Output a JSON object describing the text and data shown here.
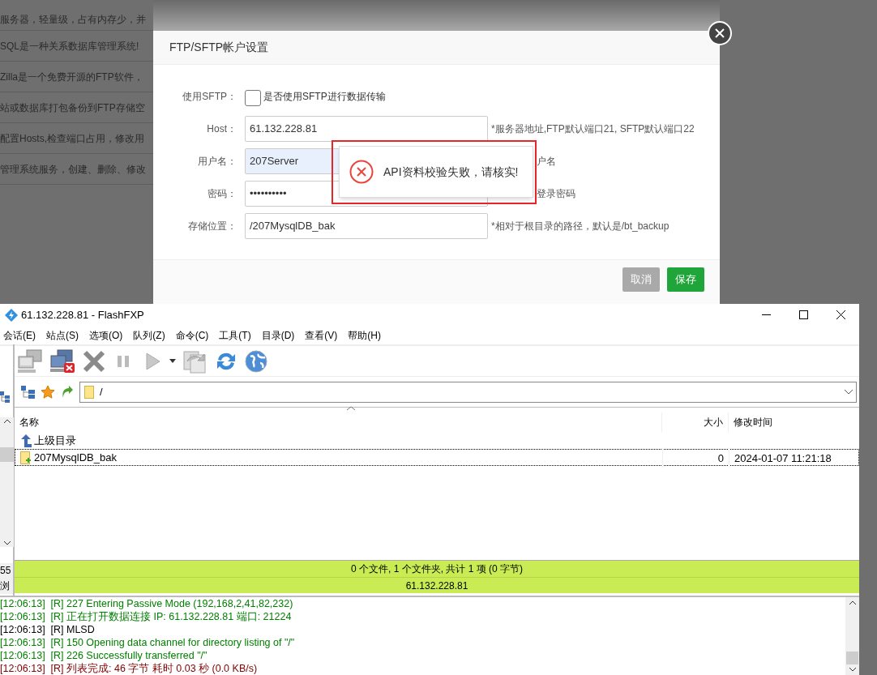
{
  "background_page": {
    "rows": [
      "服务器，轻量级，占有内存少，并",
      "SQL是一种关系数据库管理系统!",
      "Zilla是一个免费开源的FTP软件，",
      "站或数据库打包备份到FTP存储空",
      "配置Hosts,检查端口占用，修改用",
      "管理系统服务，创建、删除、修改"
    ]
  },
  "dialog": {
    "title": "FTP/SFTP帐户设置",
    "fields": [
      {
        "kind": "checkbox",
        "label": "使用SFTP：",
        "checked": false,
        "text": "是否使用SFTP进行数据传输"
      },
      {
        "kind": "input",
        "label": "Host：",
        "value": "61.132.228.81",
        "autofilled": false,
        "hint": "*服务器地址,FTP默认端口21, SFTP默认端口22"
      },
      {
        "kind": "input",
        "label": "用户名：",
        "value": "207Server",
        "autofilled": true,
        "hint": "户名"
      },
      {
        "kind": "input",
        "label": "密码：",
        "value": "••••••••••",
        "autofilled": false,
        "hint": "登录密码"
      },
      {
        "kind": "input",
        "label": "存储位置：",
        "value": "/207MysqlDB_bak",
        "autofilled": false,
        "hint": "*相对于根目录的路径，默认是/bt_backup"
      }
    ],
    "buttons": [
      {
        "label": "取消",
        "disabled": true
      },
      {
        "label": "保存",
        "disabled": false
      }
    ]
  },
  "toast": {
    "message": "API资料校验失败，请核实!"
  },
  "ftp_window": {
    "title": "61.132.228.81 - FlashFXP",
    "menu": [
      "会话(E)",
      "站点(S)",
      "选项(O)",
      "队列(Z)",
      "命令(C)",
      "工具(T)",
      "目录(D)",
      "查看(V)",
      "帮助(H)"
    ],
    "left_pane": {
      "labels": [
        "55",
        "浏"
      ]
    },
    "path": "/",
    "columns": [
      "名称",
      "大小",
      "修改时间"
    ],
    "rows": [
      {
        "kind": "parent",
        "name": "上级目录",
        "selected": false
      },
      {
        "kind": "folder",
        "name": "207MysqlDB_bak",
        "size": "0",
        "modified": "2024-01-07 11:21:18",
        "selected": true
      }
    ],
    "status": [
      "0 个文件, 1 个文件夹, 共计 1 项 (0 字节)",
      "61.132.228.81"
    ],
    "log": [
      {
        "text": "[12:06:13]  [R] 227 Entering Passive Mode (192,168,2,41,82,232)",
        "color": "#008000"
      },
      {
        "text": "[12:06:13]  [R] 正在打开数据连接 IP: 61.132.228.81 端口: 21224",
        "color": "#008000"
      },
      {
        "text": "[12:06:13]  [R] MLSD",
        "color": "#000000"
      },
      {
        "text": "[12:06:13]  [R] 150 Opening data channel for directory listing of \"/\"",
        "color": "#008000"
      },
      {
        "text": "[12:06:13]  [R] 226 Successfully transferred \"/\"",
        "color": "#008000"
      },
      {
        "text": "[12:06:13]  [R] 列表完成: 46 字节 耗时 0.03 秒 (0.0 KB/s)",
        "color": "#800000"
      }
    ]
  }
}
